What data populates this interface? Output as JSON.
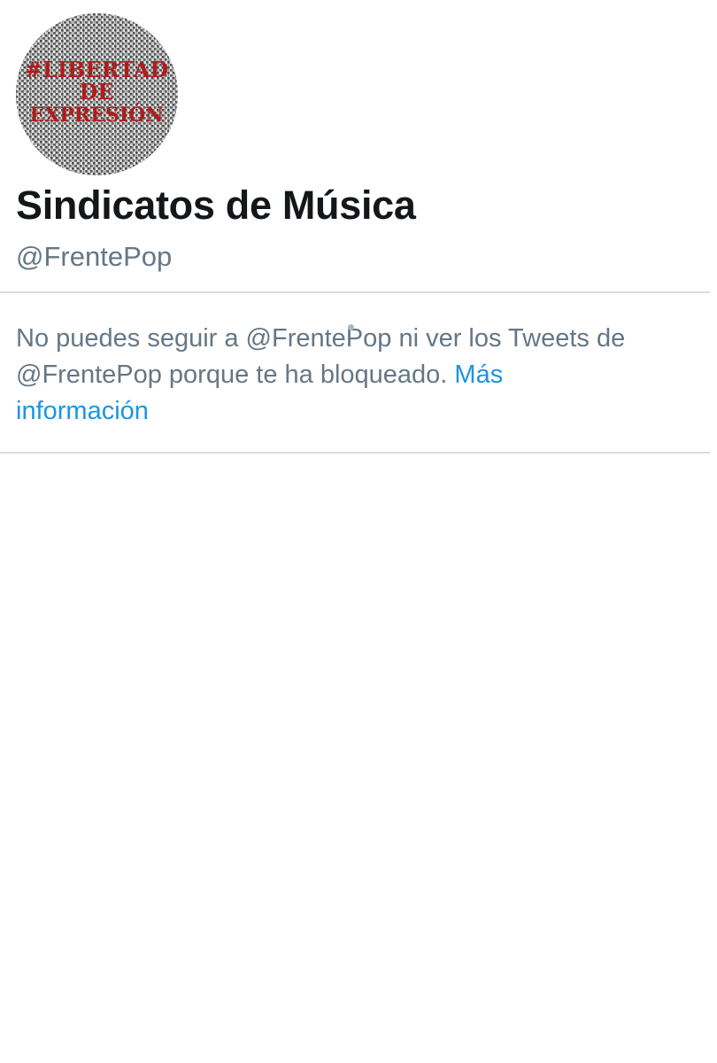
{
  "profile": {
    "avatar_text": [
      "#LIBERTAD",
      "DE",
      "EXPRESIÓN"
    ],
    "display_name": "Sindicatos de Música",
    "handle": "@FrentePop"
  },
  "blocked_notice": {
    "message": "No puedes seguir a @FrentePop ni ver los Tweets de @FrentePop porque te ha bloqueado.",
    "link_label": "Más información"
  },
  "colors": {
    "name": "#14171a",
    "secondary_text": "#657786",
    "link": "#1b95e0",
    "avatar_text": "#b01c1c"
  }
}
